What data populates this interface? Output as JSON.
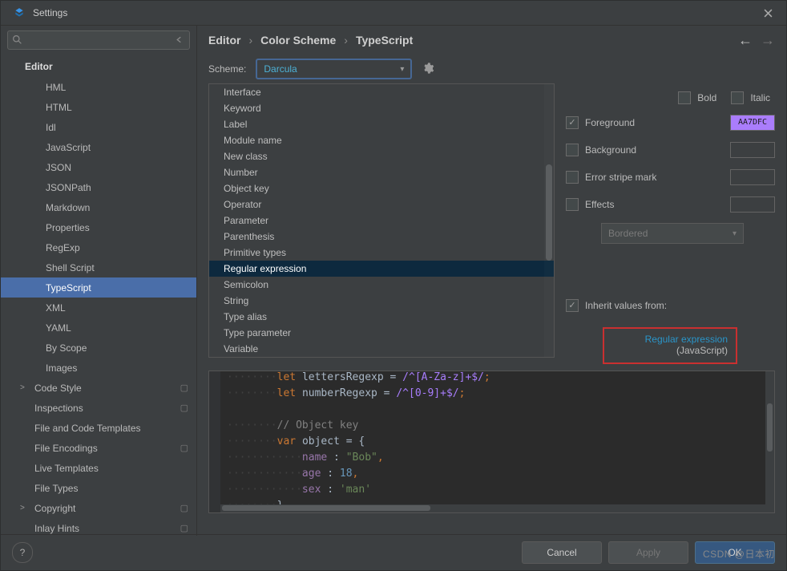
{
  "window": {
    "title": "Settings"
  },
  "search": {
    "placeholder": ""
  },
  "sidebar": {
    "header": "Editor",
    "items": [
      {
        "label": "HML",
        "indent": 2
      },
      {
        "label": "HTML",
        "indent": 2
      },
      {
        "label": "Idl",
        "indent": 2
      },
      {
        "label": "JavaScript",
        "indent": 2
      },
      {
        "label": "JSON",
        "indent": 2
      },
      {
        "label": "JSONPath",
        "indent": 2
      },
      {
        "label": "Markdown",
        "indent": 2
      },
      {
        "label": "Properties",
        "indent": 2
      },
      {
        "label": "RegExp",
        "indent": 2
      },
      {
        "label": "Shell Script",
        "indent": 2
      },
      {
        "label": "TypeScript",
        "indent": 2,
        "selected": true
      },
      {
        "label": "XML",
        "indent": 2
      },
      {
        "label": "YAML",
        "indent": 2
      },
      {
        "label": "By Scope",
        "indent": 2
      },
      {
        "label": "Images",
        "indent": 2
      },
      {
        "label": "Code Style",
        "indent": 1,
        "expand": ">",
        "cfg": true
      },
      {
        "label": "Inspections",
        "indent": 1,
        "cfg": true
      },
      {
        "label": "File and Code Templates",
        "indent": 1
      },
      {
        "label": "File Encodings",
        "indent": 1,
        "cfg": true
      },
      {
        "label": "Live Templates",
        "indent": 1
      },
      {
        "label": "File Types",
        "indent": 1
      },
      {
        "label": "Copyright",
        "indent": 1,
        "expand": ">",
        "cfg": true
      },
      {
        "label": "Inlay Hints",
        "indent": 1,
        "cfg": true
      }
    ]
  },
  "breadcrumbs": [
    "Editor",
    "Color Scheme",
    "TypeScript"
  ],
  "scheme": {
    "label": "Scheme:",
    "value": "Darcula"
  },
  "attr_list": [
    "Interface",
    "Keyword",
    "Label",
    "Module name",
    "New class",
    "Number",
    "Object key",
    "Operator",
    "Parameter",
    "Parenthesis",
    "Primitive types",
    "Regular expression",
    "Semicolon",
    "String",
    "Type alias",
    "Type parameter",
    "Variable"
  ],
  "attr_selected": "Regular expression",
  "style": {
    "bold": "Bold",
    "italic": "Italic",
    "foreground": "Foreground",
    "background": "Background",
    "error_stripe": "Error stripe mark",
    "effects": "Effects",
    "effects_kind": "Bordered",
    "fg_value": "AA7DFC",
    "inherit_label": "Inherit values from:",
    "inherit_link": "Regular expression",
    "inherit_from": "(JavaScript)"
  },
  "preview": {
    "l1_kw": "let",
    "l1_id": "lettersRegexp",
    "l1_eq": " = ",
    "l1_re": "/^[A-Za-z]+$/",
    "l1_end": ";",
    "l2_kw": "let",
    "l2_id": "numberRegexp",
    "l2_eq": " = ",
    "l2_re": "/^[0-9]+$/",
    "l2_end": ";",
    "l3_cmt": "// Object key",
    "l4_kw": "var",
    "l4_id": "object",
    "l4_rest": " = {",
    "l5_k": "name",
    "l5_c": " : ",
    "l5_v": "\"Bob\"",
    "l5_p": ",",
    "l6_k": "age",
    "l6_c": " : ",
    "l6_v": "18",
    "l6_p": ",",
    "l7_k": "sex",
    "l7_c": " : ",
    "l7_v": "'man'",
    "l8": "}"
  },
  "buttons": {
    "ok": "OK",
    "cancel": "Cancel",
    "apply": "Apply"
  },
  "watermark": "CSDN @日本初"
}
